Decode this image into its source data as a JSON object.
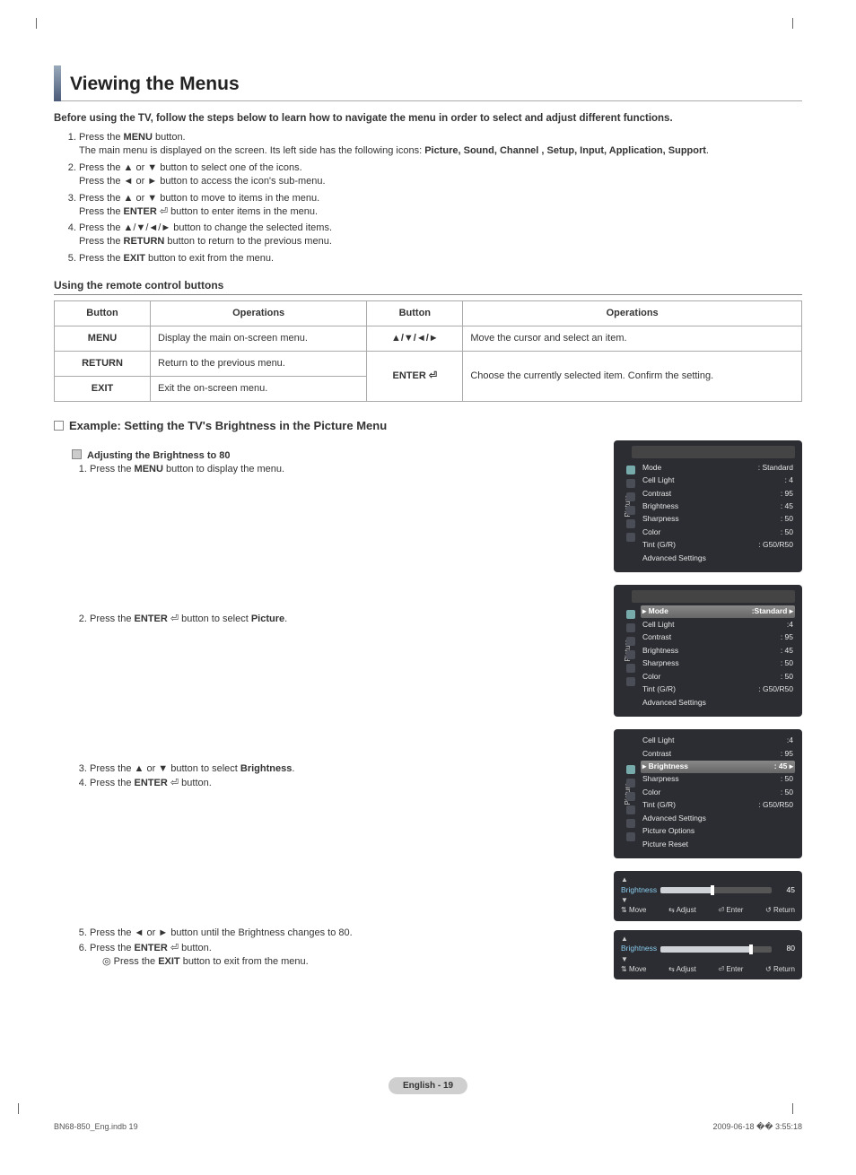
{
  "title": "Viewing the Menus",
  "intro": "Before using the TV, follow the steps below to learn how to navigate the menu in order to select and adjust different functions.",
  "steps": {
    "s1a": "Press the ",
    "s1b": "MENU",
    "s1c": " button.",
    "s1d": "The main menu is displayed on the screen. Its left side has the following icons: ",
    "s1e": "Picture, Sound, Channel , Setup, Input, Application, Support",
    "s1f": ".",
    "s2a": "Press the ▲ or ▼ button to select one of the icons.",
    "s2b": "Press the ◄ or ► button to access the icon's sub-menu.",
    "s3a": "Press the ▲ or ▼ button to move to items in the menu.",
    "s3b1": "Press the ",
    "s3b2": "ENTER",
    "s3b3": " button to enter items in the menu.",
    "s4a": "Press the ▲/▼/◄/► button to change the selected items.",
    "s4b1": "Press the ",
    "s4b2": "RETURN",
    "s4b3": " button to return to the previous menu.",
    "s5a": "Press the ",
    "s5b": "EXIT",
    "s5c": " button to exit from the menu."
  },
  "remote_heading": "Using the remote control buttons",
  "remote": {
    "th1": "Button",
    "th2": "Operations",
    "th3": "Button",
    "th4": "Operations",
    "r1b": "MENU",
    "r1o": "Display the main on-screen menu.",
    "r1b2": "▲/▼/◄/►",
    "r1o2": "Move the cursor and select an item.",
    "r2b": "RETURN",
    "r2o": "Return to the previous menu.",
    "r2b2": "ENTER",
    "r2o2": "Choose the currently selected item. Confirm the setting.",
    "r3b": "EXIT",
    "r3o": "Exit the on-screen menu."
  },
  "example_heading": "Example: Setting the TV's Brightness in the Picture Menu",
  "adjust_heading": "Adjusting the Brightness to 80",
  "ex": {
    "e1a": "Press the ",
    "e1b": "MENU",
    "e1c": " button to display the menu.",
    "e2a": "Press the ",
    "e2b": "ENTER",
    "e2c": " button to select ",
    "e2d": "Picture",
    "e2e": ".",
    "e3": "Press the ▲ or ▼ button to select ",
    "e3b": "Brightness",
    "e3c": ".",
    "e4a": "Press the ",
    "e4b": "ENTER",
    "e4c": " button.",
    "e5": "Press the ◄ or ► button until the Brightness changes to 80.",
    "e6a": "Press the ",
    "e6b": "ENTER",
    "e6c": " button.",
    "e6n1": "Press the ",
    "e6n2": "EXIT",
    "e6n3": " button to exit from the menu."
  },
  "osd": {
    "tab": "Picture",
    "items": [
      {
        "l": "Mode",
        "v": ": Standard"
      },
      {
        "l": "Cell Light",
        "v": ": 4"
      },
      {
        "l": "Contrast",
        "v": ": 95"
      },
      {
        "l": "Brightness",
        "v": ": 45"
      },
      {
        "l": "Sharpness",
        "v": ": 50"
      },
      {
        "l": "Color",
        "v": ": 50"
      },
      {
        "l": "Tint (G/R)",
        "v": ": G50/R50"
      },
      {
        "l": "Advanced Settings",
        "v": ""
      }
    ],
    "items2_sel": {
      "l": "Mode",
      "v": ":Standard"
    },
    "items2": [
      {
        "l": "Cell Light",
        "v": ":4"
      },
      {
        "l": "Contrast",
        "v": ": 95"
      },
      {
        "l": "Brightness",
        "v": ": 45"
      },
      {
        "l": "Sharpness",
        "v": ": 50"
      },
      {
        "l": "Color",
        "v": ": 50"
      },
      {
        "l": "Tint (G/R)",
        "v": ": G50/R50"
      },
      {
        "l": "Advanced Settings",
        "v": ""
      }
    ],
    "items3_top": [
      {
        "l": "Cell Light",
        "v": ":4"
      },
      {
        "l": "Contrast",
        "v": ": 95"
      }
    ],
    "items3_sel": {
      "l": "Brightness",
      "v": ": 45"
    },
    "items3": [
      {
        "l": "Sharpness",
        "v": ": 50"
      },
      {
        "l": "Color",
        "v": ": 50"
      },
      {
        "l": "Tint (G/R)",
        "v": ": G50/R50"
      },
      {
        "l": "Advanced Settings",
        "v": ""
      },
      {
        "l": "Picture Options",
        "v": ""
      },
      {
        "l": "Picture Reset",
        "v": ""
      }
    ]
  },
  "sliders": {
    "name": "Brightness",
    "val1": "45",
    "val2": "80",
    "f1": "Move",
    "f2": "Adjust",
    "f3": "Enter",
    "f4": "Return"
  },
  "footer": "English - 19",
  "print_left": "BN68-850_Eng.indb   19",
  "print_right": "2009-06-18   �� 3:55:18"
}
